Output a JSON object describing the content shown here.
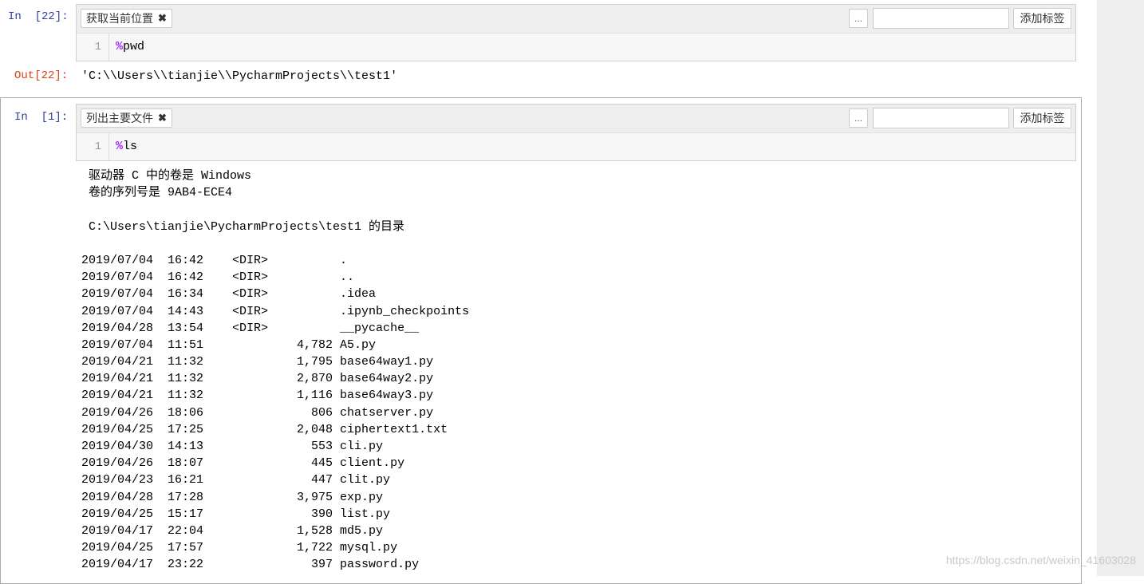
{
  "cells": [
    {
      "prompt": "In  [22]:",
      "tag": "获取当前位置",
      "more": "...",
      "add_tag_label": "添加标签",
      "line_no": "1",
      "magic": "%",
      "code": "pwd",
      "out_prompt": "Out[22]:",
      "out_text": "'C:\\\\Users\\\\tianjie\\\\PycharmProjects\\\\test1'"
    },
    {
      "prompt": "In  [1]:",
      "tag": "列出主要文件",
      "more": "...",
      "add_tag_label": "添加标签",
      "line_no": "1",
      "magic": "%",
      "code": "ls",
      "output_lines": [
        " 驱动器 C 中的卷是 Windows",
        " 卷的序列号是 9AB4-ECE4",
        "",
        " C:\\Users\\tianjie\\PycharmProjects\\test1 的目录",
        "",
        "2019/07/04  16:42    <DIR>          .",
        "2019/07/04  16:42    <DIR>          ..",
        "2019/07/04  16:34    <DIR>          .idea",
        "2019/07/04  14:43    <DIR>          .ipynb_checkpoints",
        "2019/04/28  13:54    <DIR>          __pycache__",
        "2019/07/04  11:51             4,782 A5.py",
        "2019/04/21  11:32             1,795 base64way1.py",
        "2019/04/21  11:32             2,870 base64way2.py",
        "2019/04/21  11:32             1,116 base64way3.py",
        "2019/04/26  18:06               806 chatserver.py",
        "2019/04/25  17:25             2,048 ciphertext1.txt",
        "2019/04/30  14:13               553 cli.py",
        "2019/04/26  18:07               445 client.py",
        "2019/04/23  16:21               447 clit.py",
        "2019/04/28  17:28             3,975 exp.py",
        "2019/04/25  15:17               390 list.py",
        "2019/04/17  22:04             1,528 md5.py",
        "2019/04/25  17:57             1,722 mysql.py",
        "2019/04/17  23:22               397 password.py"
      ]
    }
  ],
  "watermark": "https://blog.csdn.net/weixin_41603028"
}
